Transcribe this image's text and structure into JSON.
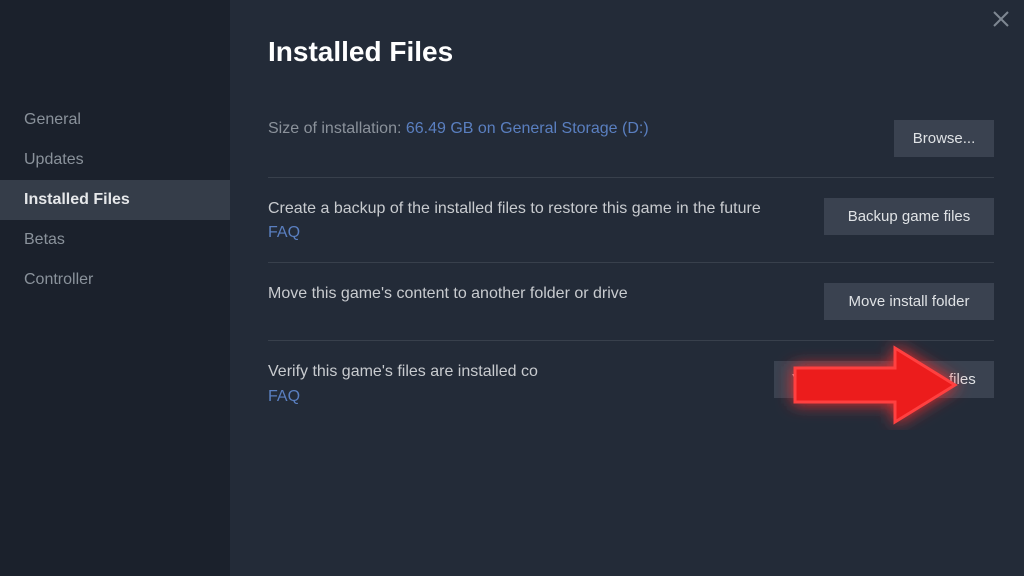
{
  "header": {
    "title": "Installed Files"
  },
  "sidebar": {
    "items": [
      {
        "label": "General"
      },
      {
        "label": "Updates"
      },
      {
        "label": "Installed Files"
      },
      {
        "label": "Betas"
      },
      {
        "label": "Controller"
      }
    ],
    "activeIndex": 2
  },
  "sections": {
    "size": {
      "label": "Size of installation: ",
      "value": "66.49 GB on General Storage (D:)",
      "button": "Browse..."
    },
    "backup": {
      "desc": "Create a backup of the installed files to restore this game in the future",
      "faq": "FAQ",
      "button": "Backup game files"
    },
    "move": {
      "desc": "Move this game's content to another folder or drive",
      "button": "Move install folder"
    },
    "verify": {
      "desc": "Verify this game's files are installed co",
      "faq": "FAQ",
      "button": "Verify integrity of game files"
    }
  },
  "colors": {
    "link": "#5a7fc0",
    "arrow_glow": "#ff0000",
    "arrow_fill": "#ec1a1a"
  }
}
